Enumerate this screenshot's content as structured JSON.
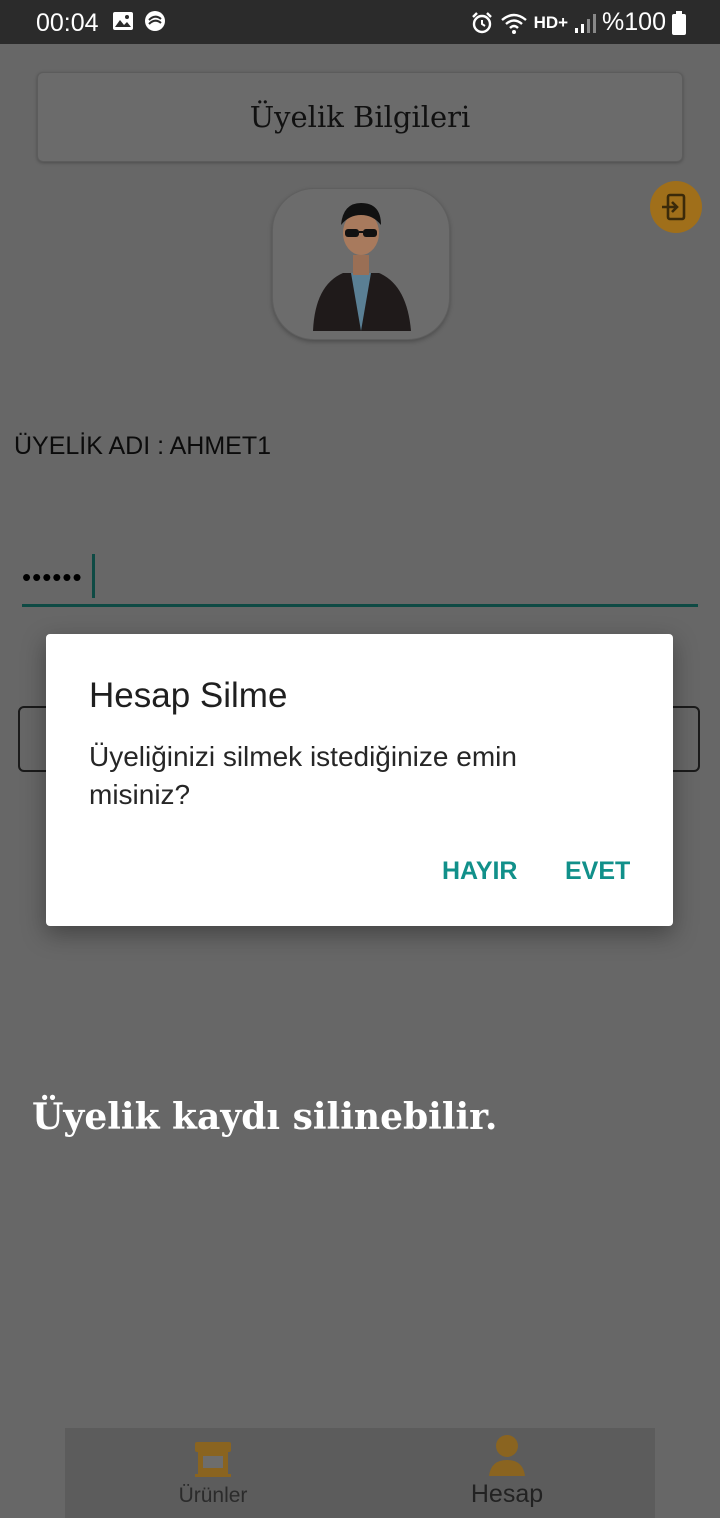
{
  "status_bar": {
    "time": "00:04",
    "network": "HD+",
    "battery": "%100"
  },
  "page": {
    "title": "Üyelik Bilgileri",
    "username_line": "ÜYELİK ADI : AHMET1",
    "password_masked": "••••••",
    "note": "Üyelik kaydı silinebilir."
  },
  "dialog": {
    "title": "Hesap Silme",
    "message": "Üyeliğinizi silmek istediğinize emin misiniz?",
    "negative": "HAYIR",
    "positive": "EVET"
  },
  "bottom_nav": {
    "items": [
      {
        "label": "Ürünler",
        "icon": "store-icon"
      },
      {
        "label": "Hesap",
        "icon": "person-icon"
      }
    ]
  },
  "colors": {
    "accent": "#11908a",
    "scrim": "#676767",
    "logout": "#a06f1a",
    "underline": "#0e4a44"
  }
}
